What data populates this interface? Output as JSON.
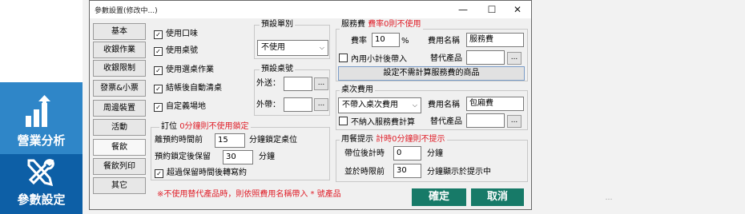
{
  "app": {
    "nav": [
      {
        "label": "營業分析",
        "icon": "bar-chart-icon"
      },
      {
        "label": "參數設定",
        "icon": "tools-icon"
      }
    ],
    "bg_bottom_text": "…",
    "bg_right_text": "…"
  },
  "dialog": {
    "title": "參數設置(修改中...)",
    "controls": {
      "minimize": "—",
      "maximize": "☐",
      "close": "✕"
    },
    "tabs": [
      "基本",
      "收銀作業",
      "收銀限制",
      "發票&小票",
      "周邊裝置",
      "活動",
      "餐飲",
      "餐飲列印",
      "其它"
    ],
    "active_tab": "餐飲",
    "options": [
      {
        "label": "使用口味",
        "checked": true
      },
      {
        "label": "使用桌號",
        "checked": true
      },
      {
        "label": "使用選桌作業",
        "checked": true
      },
      {
        "label": "結帳後自動清桌",
        "checked": true
      },
      {
        "label": "自定義場地",
        "checked": true
      }
    ],
    "order_type": {
      "title": "預設單別",
      "value": "不使用"
    },
    "table_no": {
      "title": "預設桌號",
      "takeout_label": "外送：",
      "carry_label": "外帶：",
      "takeout_value": "",
      "carry_value": "",
      "dots": "..."
    },
    "reservation": {
      "title": "訂位",
      "title_note": "0分鐘則不使用鎖定",
      "lock_label": "離預約時間前",
      "lock_value": "15",
      "lock_unit": "分鐘鎖定桌位",
      "keep_label": "預約鎖定後保留",
      "keep_value": "30",
      "keep_unit": "分鐘",
      "overdue_label": "超過保留時間後轉寫約",
      "overdue_checked": true
    },
    "service_fee": {
      "title": "服務費",
      "title_note": "費率0則不使用",
      "rate_label": "費率",
      "rate_value": "10",
      "rate_unit": "%",
      "name_label": "費用名稱",
      "name_value": "服務費",
      "inner_label": "內用小計後帶入",
      "inner_checked": false,
      "alt_label": "替代產品",
      "alt_value": "",
      "dots": "...",
      "exclude_button": "設定不需計算服務費的商品"
    },
    "table_fee": {
      "title": "桌次費用",
      "type_value": "不帶入桌次費用",
      "name_label": "費用名稱",
      "name_value": "包廂費",
      "exclude_label": "不納入服務費計算",
      "exclude_checked": false,
      "alt_label": "替代產品",
      "alt_value": "",
      "dots": "..."
    },
    "meal_reminder": {
      "title": "用餐提示",
      "title_note": "計時0分鐘則不提示",
      "timer_label": "帶位後計時",
      "timer_value": "0",
      "timer_unit": "分鐘",
      "limit_label": "並於時限前",
      "limit_value": "30",
      "limit_unit": "分鐘顯示於提示中"
    },
    "footer_note": "※不使用替代產品時，則依照費用名稱帶入 * 號產品",
    "ok_label": "確定",
    "cancel_label": "取消"
  },
  "colors": {
    "accent_green": "#177a68",
    "note_red": "#e0202a",
    "nav_blue": "#2f86c8"
  }
}
